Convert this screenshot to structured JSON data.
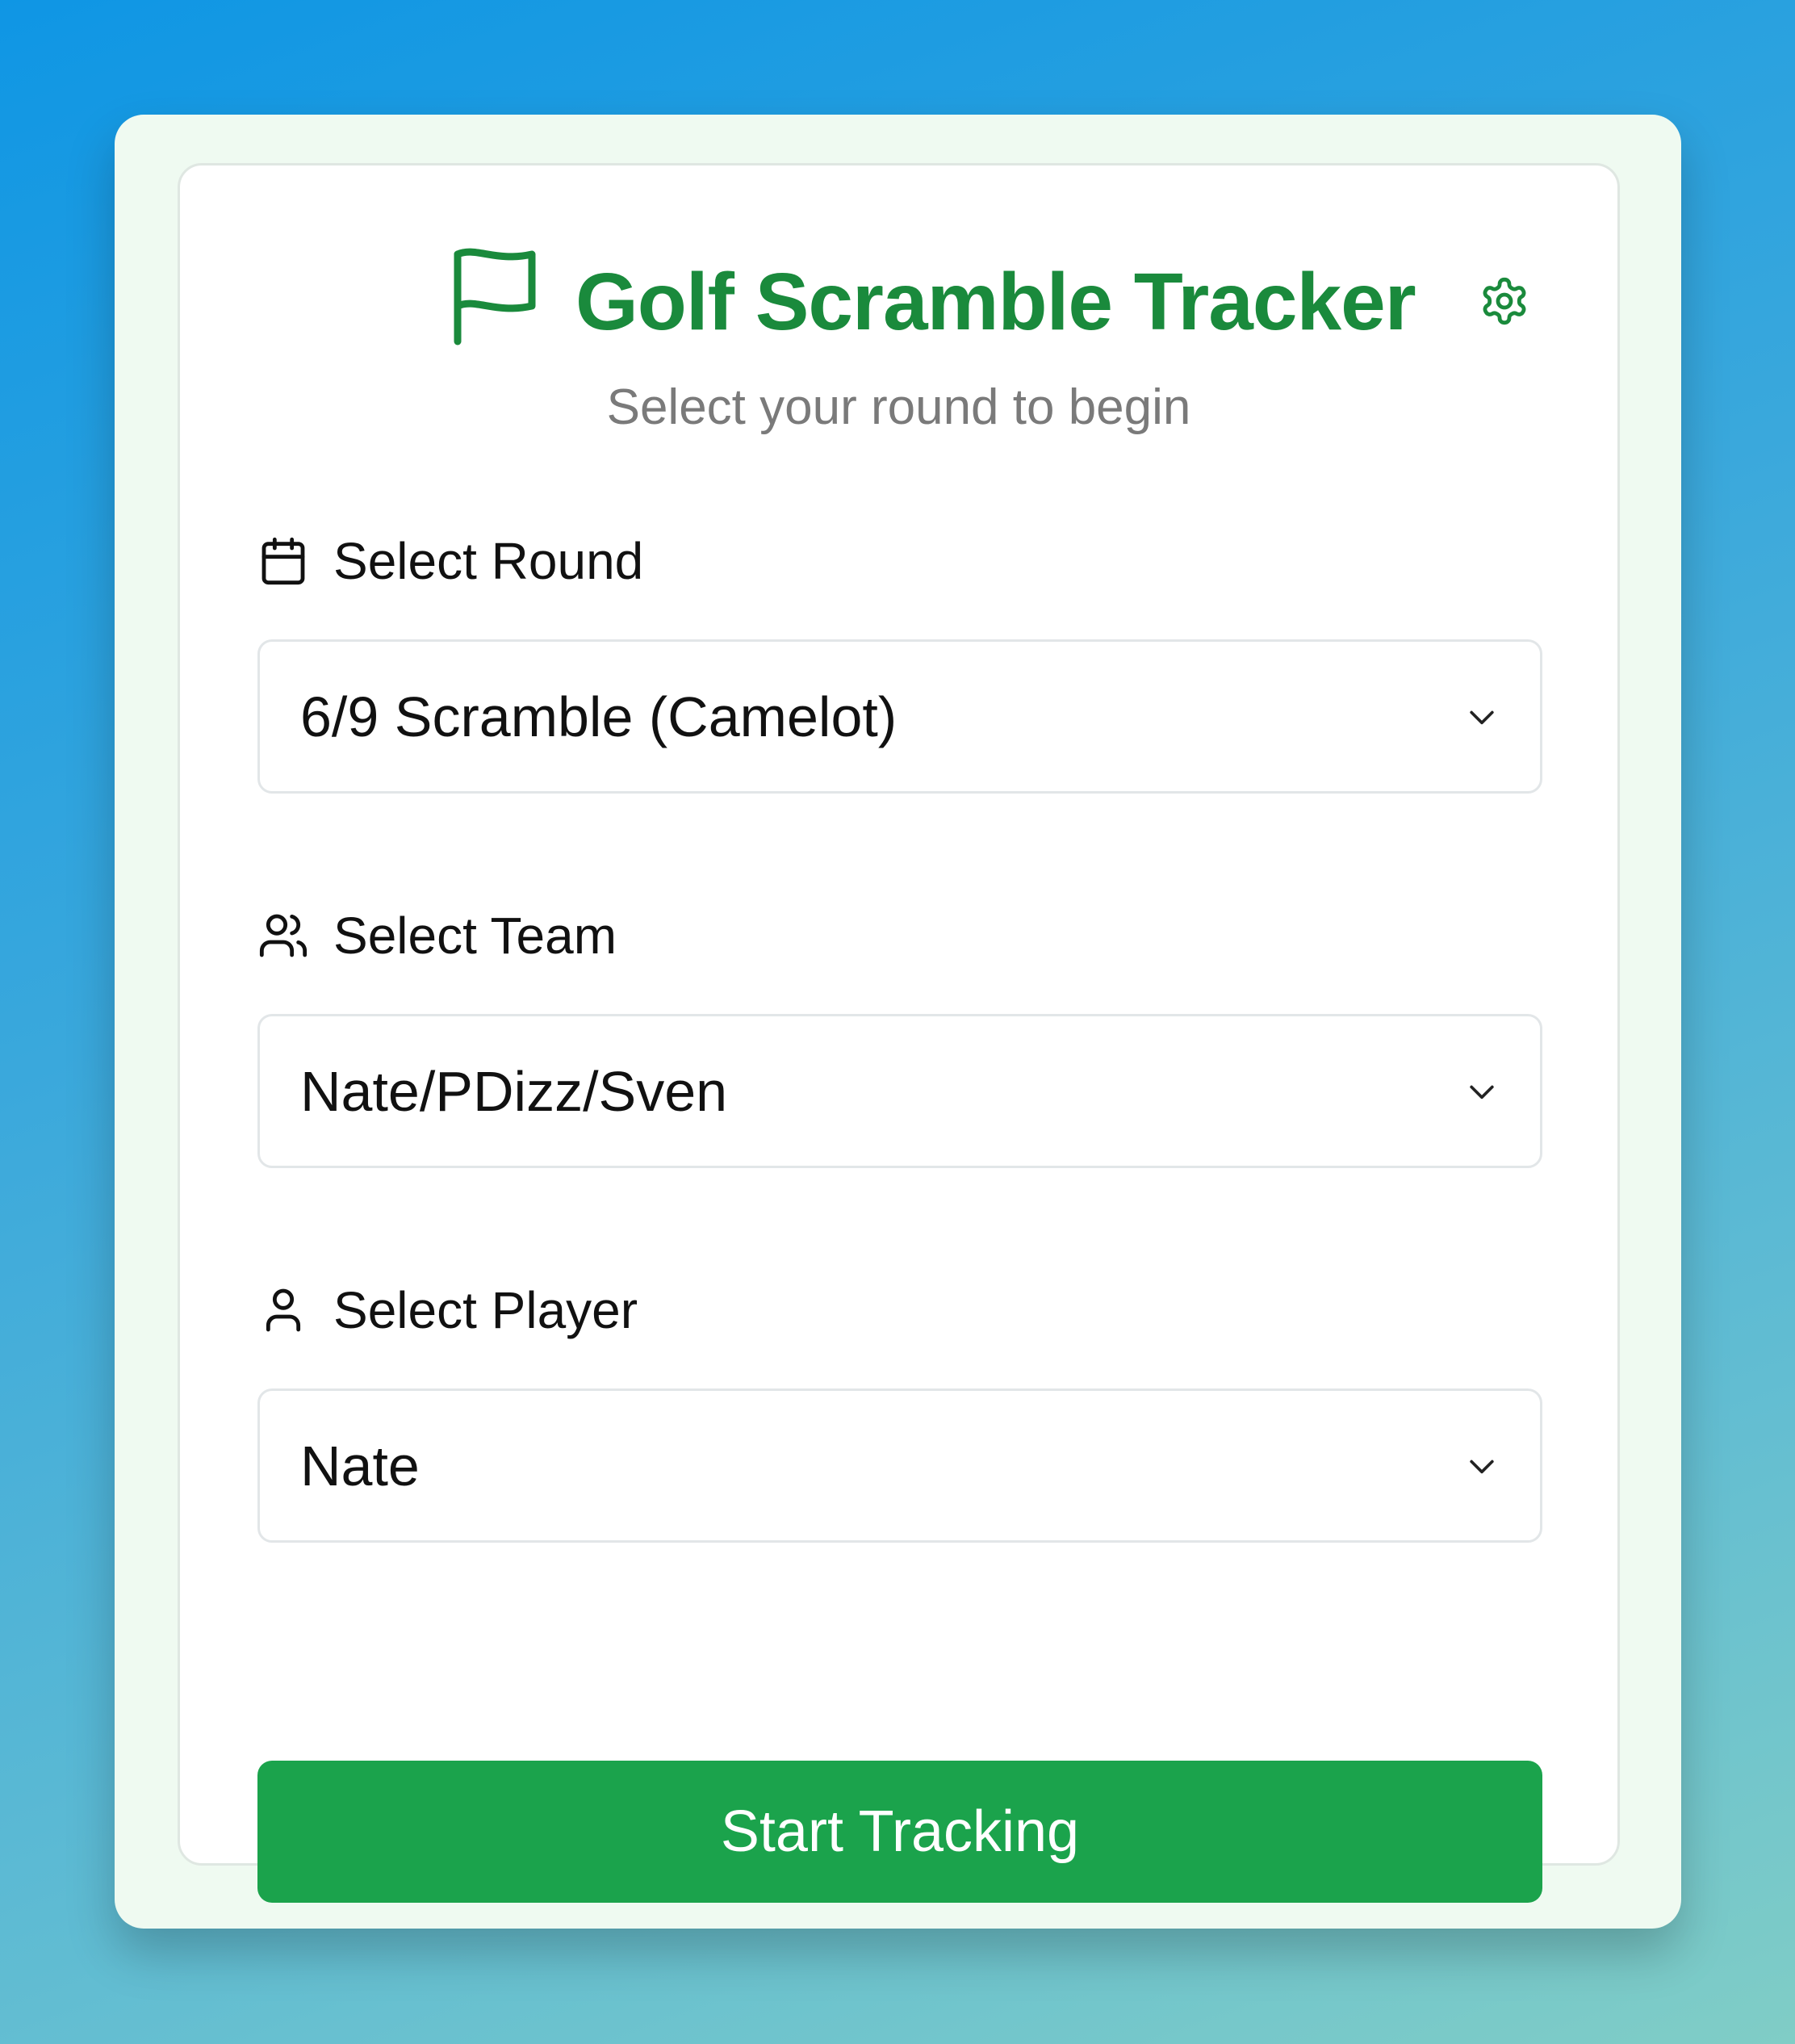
{
  "app": {
    "title": "Golf Scramble Tracker",
    "subtitle": "Select your round to begin"
  },
  "fields": {
    "round": {
      "label": "Select Round",
      "value": "6/9 Scramble (Camelot)",
      "icon": "calendar-icon"
    },
    "team": {
      "label": "Select Team",
      "value": "Nate/PDizz/Sven",
      "icon": "users-icon"
    },
    "player": {
      "label": "Select Player",
      "value": "Nate",
      "icon": "user-icon"
    }
  },
  "actions": {
    "start_label": "Start Tracking",
    "settings_icon": "gear-icon"
  },
  "colors": {
    "brand_green": "#1a8a3c",
    "button_green": "#1ba34c",
    "subtitle_gray": "#7a7a7a"
  }
}
